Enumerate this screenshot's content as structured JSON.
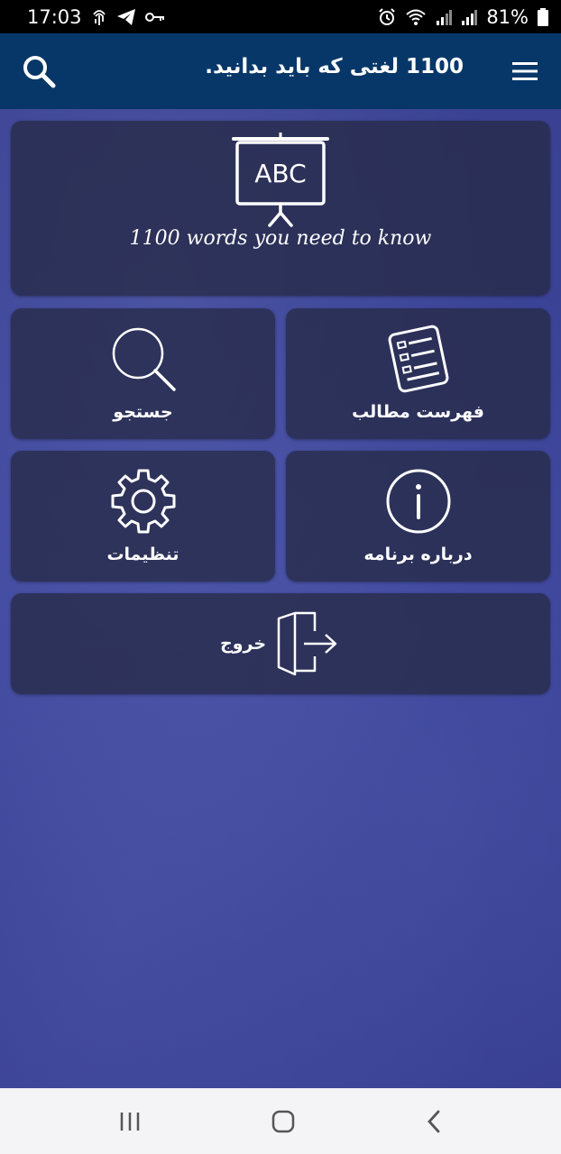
{
  "status_bar": {
    "time": "17:03",
    "battery": "81%",
    "icons_left": [
      "fingerprint-icon",
      "telegram-icon",
      "key-icon"
    ],
    "icons_right": [
      "alarm-icon",
      "wifi-icon",
      "signal-icon",
      "signal-icon",
      "battery-icon"
    ]
  },
  "app_bar": {
    "title": "1100 لغتی که باید بدانید.",
    "menu_icon": "hamburger-menu-icon",
    "search_icon": "search-icon",
    "color": "#073769"
  },
  "banner": {
    "board_text": "ABC",
    "caption": "1100 words you need to know"
  },
  "tiles": {
    "table_of_contents": {
      "label": "فهرست مطالب",
      "icon": "list-document-icon"
    },
    "search": {
      "label": "جستجو",
      "icon": "magnifier-icon"
    },
    "about": {
      "label": "درباره برنامه",
      "icon": "info-icon"
    },
    "settings": {
      "label": "تنظیمات",
      "icon": "gear-icon"
    },
    "exit": {
      "label": "خروج",
      "icon": "exit-door-icon"
    }
  },
  "nav_bar": {
    "recents": "recents-icon",
    "home": "home-icon",
    "back": "back-icon"
  }
}
